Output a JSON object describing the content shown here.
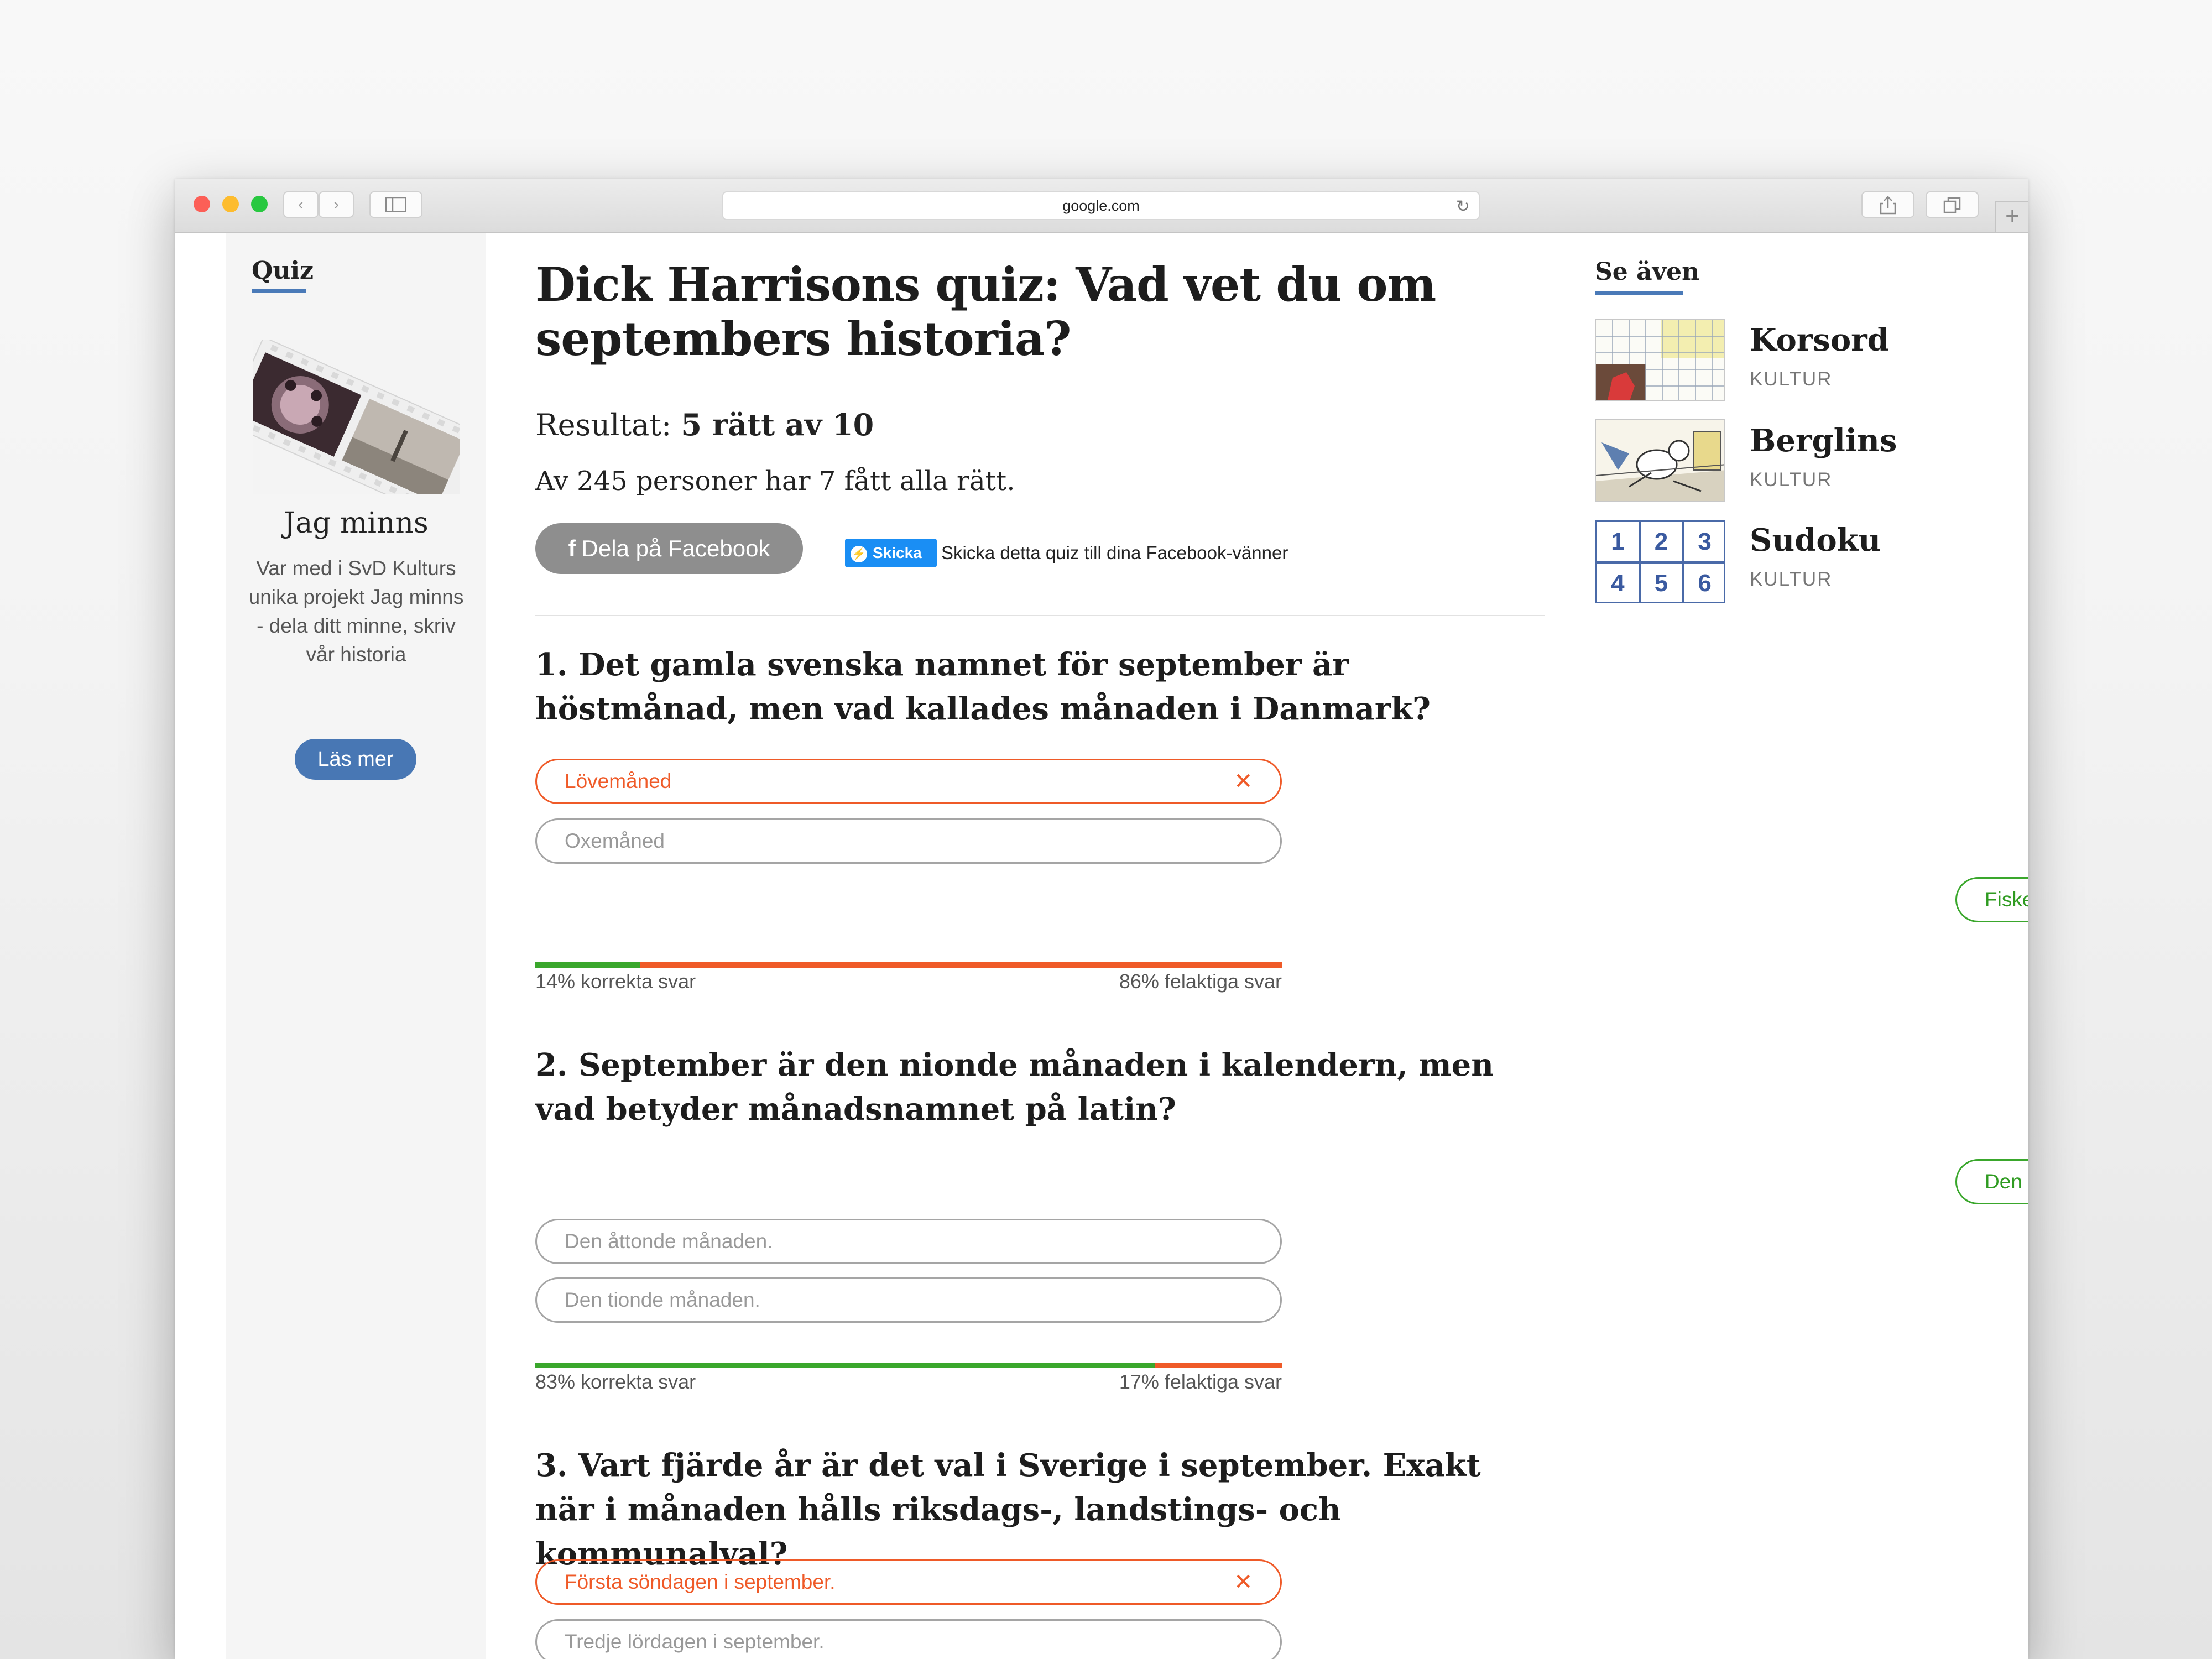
{
  "browser": {
    "url": "google.com"
  },
  "sidebar_left": {
    "tab_label": "Quiz",
    "promo_title": "Jag minns",
    "promo_text": "Var med i SvD Kulturs unika projekt Jag minns - dela ditt minne, skriv vår historia",
    "promo_button": "Läs mer"
  },
  "quiz": {
    "title": "Dick Harrisons quiz: Vad vet du om septembers historia?",
    "result_label": "Resultat:",
    "result_value": "5 rätt av 10",
    "stats": "Av 245 personer har 7 fått alla rätt.",
    "share_facebook": "Dela på Facebook",
    "messenger_button": "Skicka",
    "messenger_text": "Skicka detta quiz till dina Facebook-vänner",
    "questions": [
      {
        "title": "1. Det gamla svenska namnet för september är höstmånad, men vad kallades månaden i Danmark?",
        "options": [
          {
            "label": "Lövemåned",
            "state": "wrong",
            "mark": "✕"
          },
          {
            "label": "Oxemåned",
            "state": "neutral",
            "mark": ""
          },
          {
            "label": "Fiskemåned",
            "state": "right",
            "mark": ""
          }
        ],
        "correct_pct": 14,
        "correct_label": "14% korrekta svar",
        "wrong_label": "86% felaktiga svar"
      },
      {
        "title": "2. September är den nionde månaden i kalendern, men vad betyder månadsnamnet på latin?",
        "options": [
          {
            "label": "Den sjunde månaden.",
            "state": "right",
            "mark": "✓"
          },
          {
            "label": "Den åttonde månaden.",
            "state": "neutral",
            "mark": ""
          },
          {
            "label": "Den tionde månaden.",
            "state": "neutral",
            "mark": ""
          }
        ],
        "correct_pct": 83,
        "correct_label": "83% korrekta svar",
        "wrong_label": "17% felaktiga svar"
      },
      {
        "title": "3. Vart fjärde år är det val i Sverige i september. Exakt när i månaden hålls riksdags-, landstings- och kommunalval?",
        "options": [
          {
            "label": "Första söndagen i september.",
            "state": "wrong",
            "mark": "✕"
          },
          {
            "label": "Tredje lördagen i september.",
            "state": "neutral",
            "mark": ""
          }
        ]
      }
    ]
  },
  "sidebar_right": {
    "heading": "Se även",
    "items": [
      {
        "title": "Korsord",
        "category": "KULTUR"
      },
      {
        "title": "Berglins",
        "category": "KULTUR"
      },
      {
        "title": "Sudoku",
        "category": "KULTUR",
        "digits": [
          "1",
          "2",
          "3",
          "4",
          "5",
          "6"
        ]
      }
    ]
  },
  "colors": {
    "accent_blue": "#4a7ab8",
    "correct_green": "#3aa72c",
    "wrong_orange": "#ef5a28"
  }
}
